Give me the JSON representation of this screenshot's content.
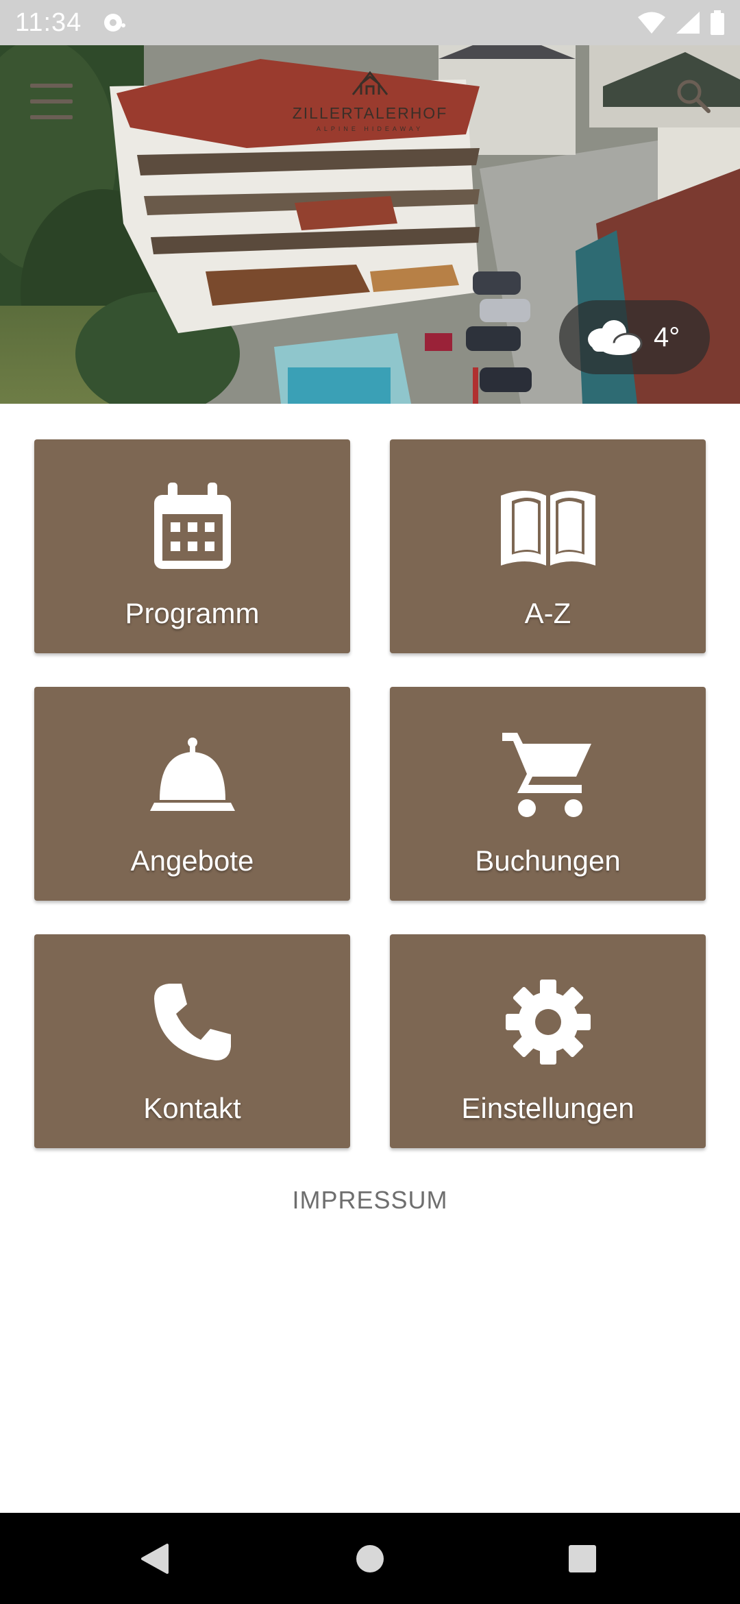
{
  "status_bar": {
    "time": "11:34"
  },
  "hero": {
    "logo_name": "ZILLERTALERHOF",
    "logo_tagline": "ALPINE HIDEAWAY",
    "weather": {
      "icon": "cloud-icon",
      "temperature": "4°"
    }
  },
  "tiles": [
    {
      "label": "Programm",
      "icon": "calendar-icon"
    },
    {
      "label": "A-Z",
      "icon": "book-icon"
    },
    {
      "label": "Angebote",
      "icon": "service-bell-icon"
    },
    {
      "label": "Buchungen",
      "icon": "cart-icon"
    },
    {
      "label": "Kontakt",
      "icon": "phone-icon"
    },
    {
      "label": "Einstellungen",
      "icon": "gear-icon"
    }
  ],
  "footer": {
    "impressum": "IMPRESSUM"
  },
  "colors": {
    "tile_bg": "#7d6753",
    "status_bar": "#d0d0d0",
    "nav_bar": "#000000"
  }
}
